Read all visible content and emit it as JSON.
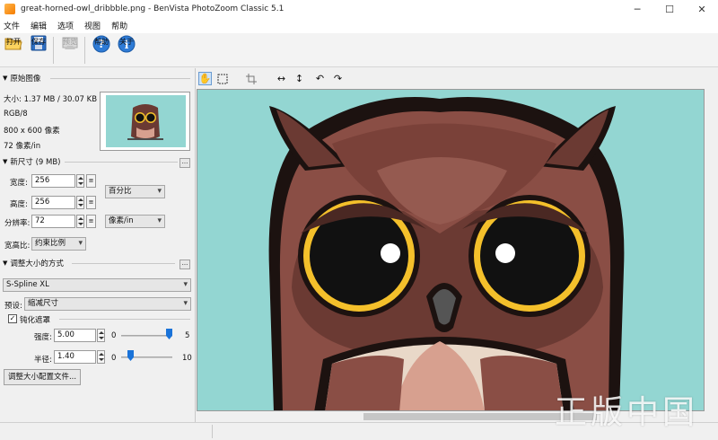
{
  "window": {
    "title": "great-horned-owl_dribbble.png - BenVista PhotoZoom Classic 5.1"
  },
  "menu": [
    "文件",
    "编辑",
    "选项",
    "视图",
    "帮助"
  ],
  "toolbar": {
    "open": "打开",
    "save": "保存",
    "preview": "预览",
    "help": "帮助",
    "about": "关于"
  },
  "original_image": {
    "header": "原始图像",
    "size": "大小: 1.37 MB / 30.07 KB",
    "mode": "RGB/8",
    "dimensions": "800 x 600 像素",
    "resolution": "72 像素/in"
  },
  "new_size": {
    "header": "新尺寸 (9 MB)",
    "width_label": "宽度:",
    "width_value": "256",
    "height_label": "高度:",
    "height_value": "256",
    "resolution_label": "分辨率:",
    "resolution_value": "72",
    "size_unit": "百分比",
    "resolution_unit": "像素/in",
    "aspect_label": "宽高比:",
    "aspect_value": "约束比例"
  },
  "resize_method": {
    "header": "调整大小的方式",
    "method": "S-Spline XL",
    "preset_label": "预设:",
    "preset_value": "缩减尺寸",
    "unsharp_label": "钝化遮罩",
    "unsharp_checked": true,
    "strength_label": "强度:",
    "strength_value": "5.00",
    "strength_min": "0",
    "strength_max": "5",
    "strength_level": 1.0,
    "radius_label": "半径:",
    "radius_value": "1.40",
    "radius_min": "0",
    "radius_max": "10",
    "radius_level": 0.14,
    "profile_button": "调整大小配置文件..."
  },
  "view_tools": [
    "hand-tool-icon",
    "select-tool-icon",
    "crop-icon",
    "fit-width-icon",
    "fit-height-icon",
    "rotate-left-icon",
    "rotate-right-icon"
  ],
  "colors": {
    "canvas_bg": "#93d6d2",
    "owl_dark": "#6b3a33",
    "owl_mid": "#8a4e45",
    "owl_light": "#d7a08f",
    "eye_ring": "#f4c02b",
    "accent_blue": "#1a73d9"
  }
}
